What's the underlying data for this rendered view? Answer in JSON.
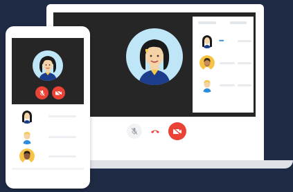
{
  "colors": {
    "background": "#1f2b45",
    "device_body": "#ffffff",
    "screen": "#262626",
    "avatar_bg": "#bfe6f7",
    "danger": "#ea4335",
    "muted_control": "#f1f3f4",
    "placeholder_line": "#e8eaed"
  },
  "laptop": {
    "main_participant": {
      "icon": "woman-avatar-icon"
    },
    "participants_panel": {
      "rows": [
        {
          "icon": "woman-avatar-icon",
          "indicator": "speaking-dots-icon"
        },
        {
          "icon": "man-beard-avatar-icon"
        },
        {
          "icon": "man-avatar-icon"
        }
      ]
    },
    "controls": [
      {
        "name": "mute-button",
        "icon": "mic-off-icon"
      },
      {
        "name": "hangup-button",
        "icon": "phone-hangup-icon"
      },
      {
        "name": "camera-off-button",
        "icon": "camera-off-icon"
      }
    ]
  },
  "phone": {
    "main_participant": {
      "icon": "woman-avatar-icon"
    },
    "controls": [
      {
        "name": "mute-button",
        "icon": "mic-off-icon"
      },
      {
        "name": "camera-off-button",
        "icon": "camera-off-icon"
      }
    ],
    "participants": [
      {
        "icon": "woman-avatar-icon"
      },
      {
        "icon": "man-avatar-icon"
      },
      {
        "icon": "man-dark-avatar-icon"
      }
    ]
  }
}
